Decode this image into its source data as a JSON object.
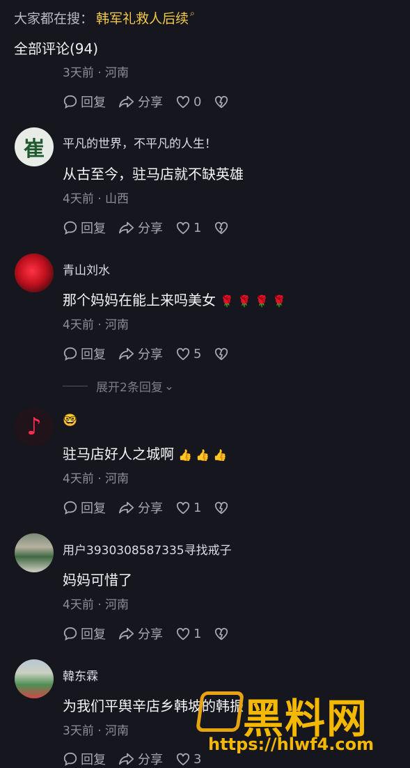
{
  "top": {
    "label": "大家都在搜：",
    "keyword": "韩军礼救人后续",
    "search_icon": "search-icon"
  },
  "comments_count": "全部评论(94)",
  "actions": {
    "reply": "回复",
    "share": "分享"
  },
  "comments": [
    {
      "content": "",
      "meta": "3天前 · 河南",
      "likes": "0"
    },
    {
      "username": "平凡的世界，不平凡的人生！",
      "avatar_text": "崔",
      "content": "从古至今，驻马店就不缺英雄",
      "meta": "4天前 · 山西",
      "likes": "1"
    },
    {
      "username": "青山刘水",
      "content": "那个妈妈在能上来吗美女",
      "emojis": "🌹 🌹 🌹 🌹",
      "meta": "4天前 · 河南",
      "likes": "5",
      "expand": "展开2条回复"
    },
    {
      "username": "🤓",
      "content": "驻马店好人之城啊",
      "emojis": "👍 👍 👍",
      "meta": "4天前 · 河南",
      "likes": "1"
    },
    {
      "username": "用户3930308587335寻找戒子",
      "content": "妈妈可惜了",
      "meta": "4天前 · 河南",
      "likes": "1"
    },
    {
      "username": "韓东霖",
      "content": "为我们平舆辛店乡韩坡的韩",
      "content_tail": "振",
      "meta": "3天前 · 河南",
      "likes": "3"
    }
  ],
  "watermark": {
    "text": "黑料网",
    "url": "https://hlwf4.com"
  },
  "colors": {
    "background": "#16161e",
    "keyword": "#f2c94c",
    "watermark": "#f5b800"
  }
}
